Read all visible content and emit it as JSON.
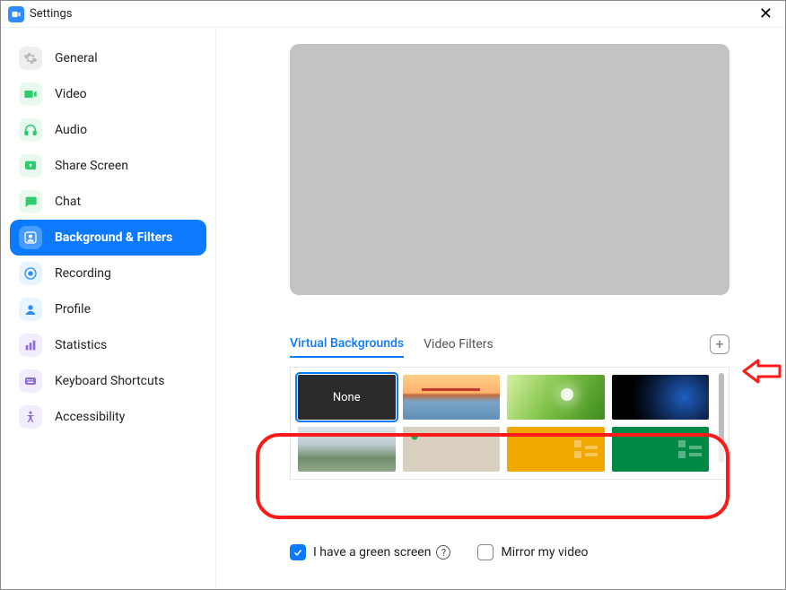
{
  "window": {
    "title": "Settings"
  },
  "sidebar": {
    "items": [
      {
        "label": "General"
      },
      {
        "label": "Video"
      },
      {
        "label": "Audio"
      },
      {
        "label": "Share Screen"
      },
      {
        "label": "Chat"
      },
      {
        "label": "Background & Filters"
      },
      {
        "label": "Recording"
      },
      {
        "label": "Profile"
      },
      {
        "label": "Statistics"
      },
      {
        "label": "Keyboard Shortcuts"
      },
      {
        "label": "Accessibility"
      }
    ]
  },
  "tabs": {
    "virtual_backgrounds": "Virtual Backgrounds",
    "video_filters": "Video Filters"
  },
  "thumbs": {
    "none_label": "None"
  },
  "controls": {
    "green_screen": "I have a green screen",
    "mirror": "Mirror my video",
    "help_char": "?",
    "add_char": "+"
  },
  "colors": {
    "accent": "#0b7aff"
  }
}
